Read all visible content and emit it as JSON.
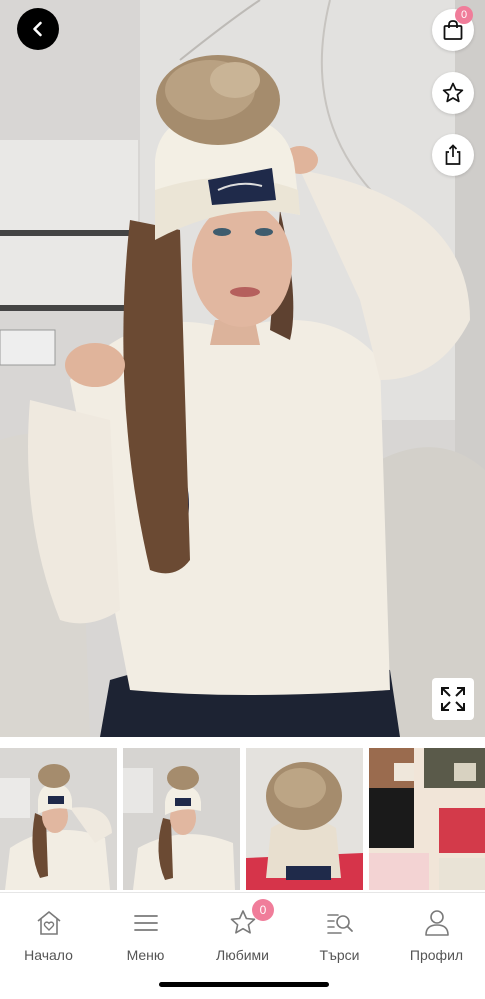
{
  "top_bar": {
    "back_icon": "chevron-left-icon",
    "cart_icon": "shopping-bag-icon",
    "cart_count": "0",
    "favorite_icon": "star-outline-icon",
    "share_icon": "share-icon",
    "expand_icon": "expand-arrows-icon"
  },
  "thumbnails": [
    {
      "icon": "product-photo-1"
    },
    {
      "icon": "product-photo-2"
    },
    {
      "icon": "product-photo-3"
    },
    {
      "icon": "product-photo-4"
    }
  ],
  "bottom_nav": {
    "items": [
      {
        "label": "Начало",
        "icon": "home-heart-icon"
      },
      {
        "label": "Меню",
        "icon": "menu-lines-icon"
      },
      {
        "label": "Любими",
        "icon": "star-outline-icon"
      },
      {
        "label": "Търси",
        "icon": "search-list-icon"
      },
      {
        "label": "Профил",
        "icon": "user-icon"
      }
    ],
    "favorites_count": "0"
  },
  "colors": {
    "badge": "#f07d9a",
    "nav_label": "#555555",
    "back_button": "#000000"
  }
}
